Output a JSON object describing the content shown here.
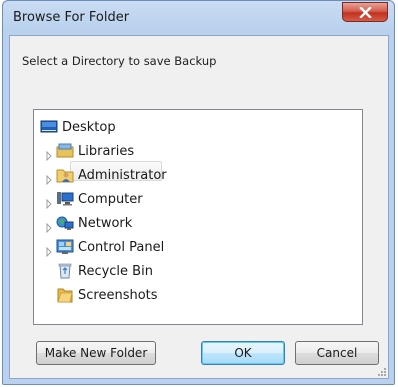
{
  "window": {
    "title": "Browse For Folder"
  },
  "instruction": "Select a Directory to save Backup",
  "tree": {
    "items": [
      {
        "label": "Desktop",
        "icon": "desktop-icon",
        "expandable": false
      },
      {
        "label": "Libraries",
        "icon": "libraries-icon",
        "expandable": true
      },
      {
        "label": "Administrator",
        "icon": "user-folder-icon",
        "expandable": true,
        "selected": true
      },
      {
        "label": "Computer",
        "icon": "computer-icon",
        "expandable": true
      },
      {
        "label": "Network",
        "icon": "network-icon",
        "expandable": true
      },
      {
        "label": "Control Panel",
        "icon": "control-panel-icon",
        "expandable": true
      },
      {
        "label": "Recycle Bin",
        "icon": "recycle-bin-icon",
        "expandable": false
      },
      {
        "label": "Screenshots",
        "icon": "folder-icon",
        "expandable": false
      }
    ]
  },
  "buttons": {
    "make_new_folder": "Make New Folder",
    "ok": "OK",
    "cancel": "Cancel"
  },
  "colors": {
    "title_bar": "#b9d1ee",
    "close_button": "#c2311f",
    "selection": "#ededed",
    "default_button_border": "#3c7fb1"
  }
}
